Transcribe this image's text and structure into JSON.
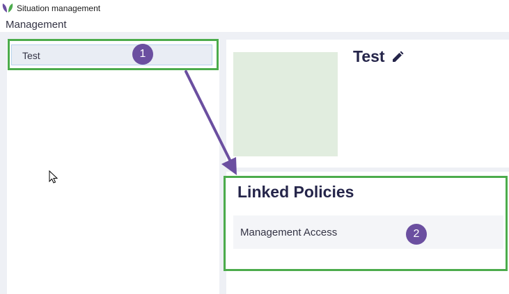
{
  "window": {
    "title": "Situation management",
    "logo_icon": "leaf-logo-icon"
  },
  "menubar": {
    "management_label": "Management"
  },
  "sidebar": {
    "items": [
      {
        "label": "Test"
      }
    ]
  },
  "annotations": {
    "badge_1": "1",
    "badge_2": "2",
    "highlight_color": "#4cac4c",
    "badge_color": "#6b4fa0"
  },
  "main": {
    "title": "Test",
    "edit_icon": "pencil-icon",
    "linked_policies": {
      "heading": "Linked Policies",
      "items": [
        {
          "label": "Management Access"
        }
      ]
    }
  },
  "colors": {
    "accent": "#6b4fa0",
    "thumbnail": "#e1eddf",
    "title_text": "#25254a"
  }
}
